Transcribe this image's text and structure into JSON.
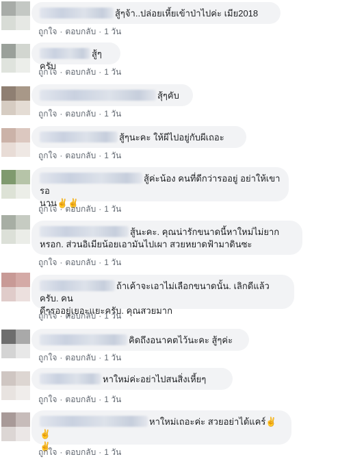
{
  "actions": {
    "like": "ถูกใจ",
    "reply": "ตอบกลับ",
    "sep": "·"
  },
  "comments": [
    {
      "line1": "สู้ๆจ้า..ปล่อยเหี้ยเข้าป่าไปค่ะ เมีย2018",
      "line2": "",
      "time": "1 วัน",
      "emoji": ""
    },
    {
      "line1": "สู้ๆครับ",
      "line2": "",
      "time": "1 วัน",
      "emoji": ""
    },
    {
      "line1": "สุ้ๆคับ",
      "line2": "",
      "time": "1 วัน",
      "emoji": ""
    },
    {
      "line1": "สู้ๆนะคะ ให้ผีไปอยู่กับผีเถอะ",
      "line2": "",
      "time": "1 วัน",
      "emoji": ""
    },
    {
      "line1": "สู้ค่ะน้อง คนที่ดีกว่ารออยู่ อย่าให้เขารอ",
      "line2": "นาน",
      "time": "1 วัน",
      "emoji": "✌✌"
    },
    {
      "line1": "สู้นะคะ. คุณน่ารักขนาดนี้หาใหม่ไม่ยาก",
      "line2": "หรอก. ส่วนอิเมียน้อยเอามันไปเผา สวยหยาดฟ้ามาดินซะ",
      "time": "1 วัน",
      "emoji": ""
    },
    {
      "line1": "ถ้าเค้าจะเอาไม่เลือกขนาดนั้น. เลิกดีแล้วครับ. คน",
      "line2": "ดีๆรออยู่เยอะแยะครับ. คุณสวยมาก",
      "time": "1 วัน",
      "emoji": ""
    },
    {
      "line1": "คิดถึงอนาคตไว้นะคะ สู้ๆค่ะ",
      "line2": "",
      "time": "1 วัน",
      "emoji": ""
    },
    {
      "line1": "หาใหม่ค่ะอย่าไปสนสิ่งเหี้ยๆ",
      "line2": "",
      "time": "1 วัน",
      "emoji": ""
    },
    {
      "line1": "หาใหม่เถอะค่ะ สวยอย่าได้แคร์",
      "line2": "",
      "time": "1 วัน",
      "emoji": "✌✌",
      "emoji2": "✌"
    }
  ]
}
